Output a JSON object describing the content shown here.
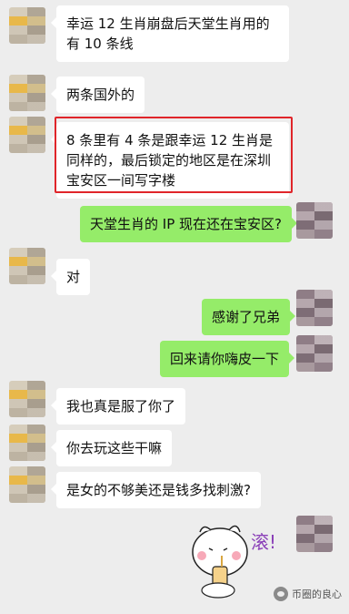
{
  "messages": [
    {
      "side": "in",
      "text": "幸运 12 生肖崩盘后天堂生肖用的有 10 条线"
    },
    {
      "side": "in",
      "text": "两条国外的"
    },
    {
      "side": "in",
      "text": "8 条里有 4 条是跟幸运 12 生肖是同样的，最后锁定的地区是在深圳宝安区一间写字楼"
    },
    {
      "side": "out",
      "text": "天堂生肖的 IP 现在还在宝安区?"
    },
    {
      "side": "in",
      "text": "对"
    },
    {
      "side": "out",
      "text": "感谢了兄弟"
    },
    {
      "side": "out",
      "text": "回来请你嗨皮一下"
    },
    {
      "side": "in",
      "text": "我也真是服了你了"
    },
    {
      "side": "in",
      "text": "你去玩这些干嘛"
    },
    {
      "side": "in",
      "text": "是女的不够美还是钱多找刺激?"
    }
  ],
  "sticker": {
    "text": "滚!"
  },
  "watermark": {
    "text": "币圈的良心"
  },
  "colors": {
    "out_bubble": "#95ec69",
    "in_bubble": "#ffffff",
    "highlight": "#e0252a",
    "background": "#ededed"
  }
}
